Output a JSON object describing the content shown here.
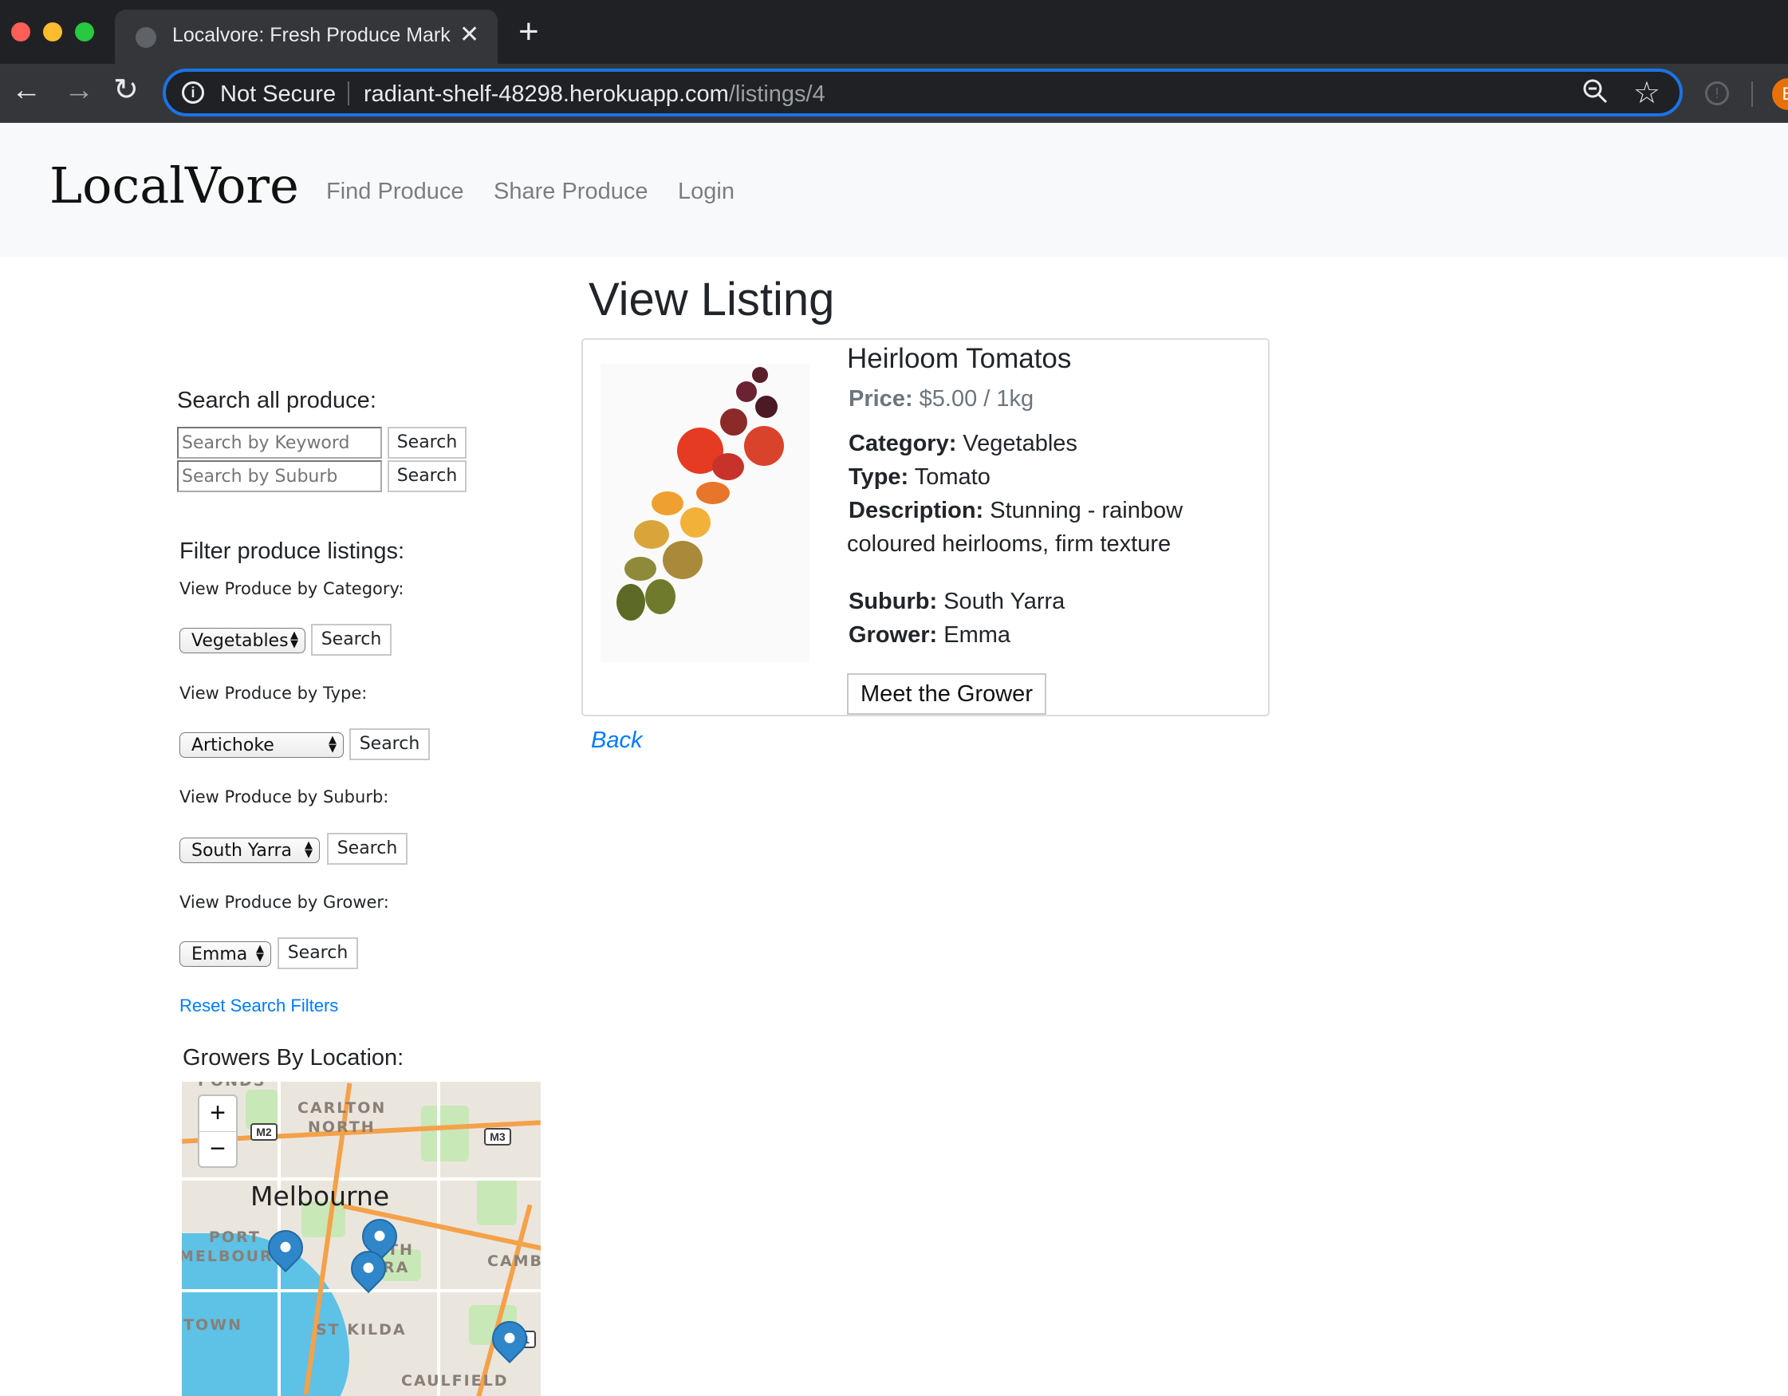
{
  "browser": {
    "tab_title": "Localvore: Fresh Produce Mark",
    "new_tab_symbol": "+",
    "security_label": "Not Secure",
    "url_host": "radiant-shelf-48298.herokuapp.com",
    "url_path": "/listings/4"
  },
  "nav": {
    "brand": "LocalVore",
    "links": [
      "Find Produce",
      "Share Produce",
      "Login"
    ]
  },
  "sidebar": {
    "search_heading": "Search all produce:",
    "keyword_placeholder": "Search by Keyword",
    "suburb_placeholder": "Search by Suburb",
    "search_label": "Search",
    "filter_heading": "Filter produce listings:",
    "filters": [
      {
        "label": "View Produce by Category:",
        "selected": "Vegetables"
      },
      {
        "label": "View Produce by Type:",
        "selected": "Artichoke"
      },
      {
        "label": "View Produce by Suburb:",
        "selected": "South Yarra"
      },
      {
        "label": "View Produce by Grower:",
        "selected": "Emma"
      }
    ],
    "reset_label": "Reset Search Filters",
    "map_heading": "Growers By Location:"
  },
  "map": {
    "city": "Melbourne",
    "places": [
      "CARLTON",
      "NORTH",
      "PORT",
      "MELBOURNE",
      "RA",
      "TH",
      "CAMB",
      "TOWN",
      "ST KILDA",
      "CAULFIELD",
      "PONDS"
    ],
    "shields": [
      "M2",
      "M3",
      "1"
    ],
    "zoom_in": "+",
    "zoom_out": "−",
    "marker_count": 4
  },
  "listing": {
    "page_title": "View Listing",
    "name": "Heirloom Tomatos",
    "price_label": "Price:",
    "price_value": "$5.00 / 1kg",
    "category_label": "Category:",
    "category_value": "Vegetables",
    "type_label": "Type:",
    "type_value": "Tomato",
    "description_label": "Description:",
    "description_line1": "Stunning - rainbow",
    "description_line2": "coloured heirlooms, firm texture",
    "suburb_label": "Suburb:",
    "suburb_value": "South Yarra",
    "grower_label": "Grower:",
    "grower_value": "Emma",
    "grower_button": "Meet the Grower",
    "back_label": "Back"
  }
}
